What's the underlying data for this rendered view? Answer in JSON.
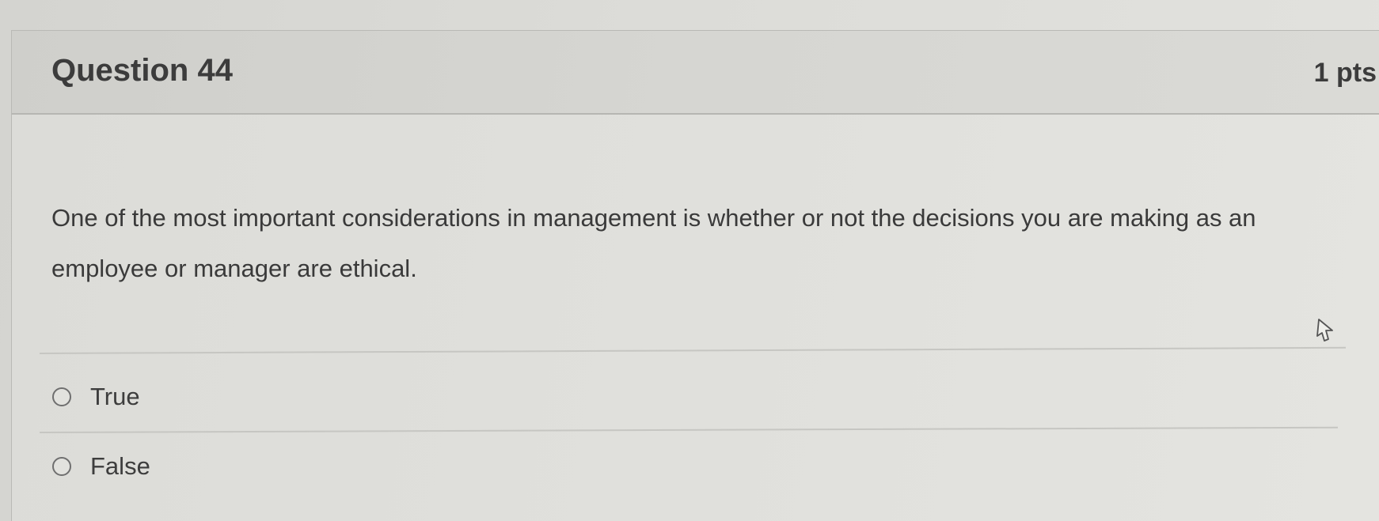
{
  "question": {
    "title": "Question 44",
    "points": "1 pts",
    "text": "One of the most important considerations in management is whether or not the decisions you are making as an employee or manager are ethical."
  },
  "answers": [
    {
      "label": "True",
      "selected": false
    },
    {
      "label": "False",
      "selected": false
    }
  ],
  "cursor": {
    "icon": "hand-pointer-icon"
  }
}
